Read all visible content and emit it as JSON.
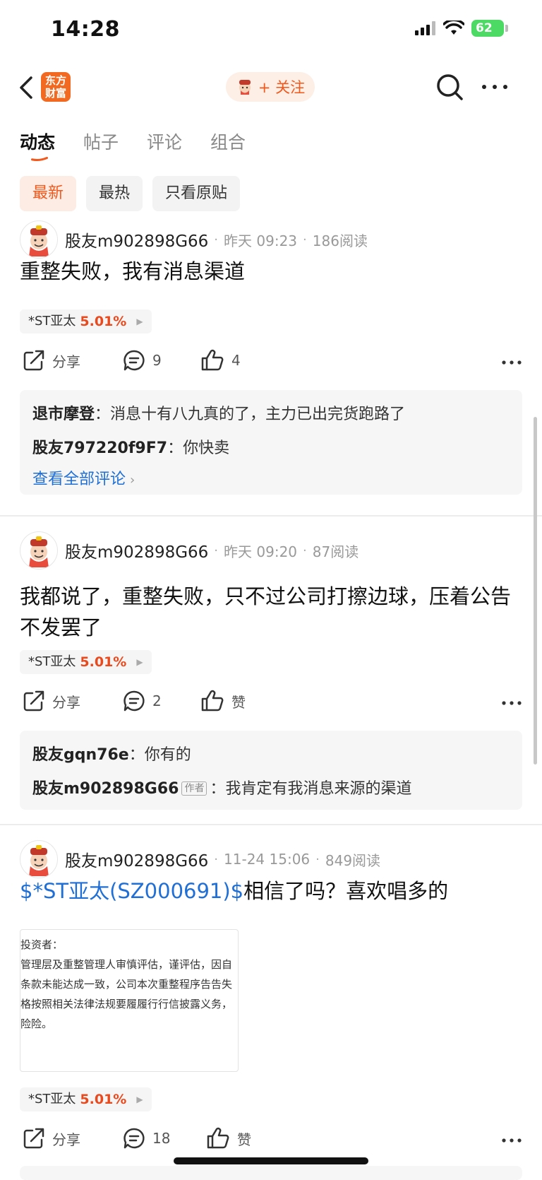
{
  "status_bar": {
    "time": "14:28",
    "battery": "62"
  },
  "nav": {
    "logo_text_line1": "东方",
    "logo_text_line2": "财富",
    "follow_label": "+ 关注"
  },
  "tabs": [
    "动态",
    "帖子",
    "评论",
    "组合"
  ],
  "filters": [
    "最新",
    "最热",
    "只看原贴"
  ],
  "posts": [
    {
      "author": "股友m902898G66",
      "time": "昨天 09:23",
      "reads": "186阅读",
      "text": "重整失败，我有消息渠道",
      "stock_name": "*ST亚太",
      "stock_pct": "5.01%",
      "share_label": "分享",
      "comments_count": "9",
      "likes": "4",
      "comments": [
        {
          "name": "退市摩登",
          "text": "消息十有八九真的了，主力已出完货跑路了"
        },
        {
          "name": "股友797220f9F7",
          "text": "你快卖"
        }
      ],
      "view_all": "查看全部评论"
    },
    {
      "author": "股友m902898G66",
      "time": "昨天 09:20",
      "reads": "87阅读",
      "text": "我都说了，重整失败，只不过公司打擦边球，压着公告不发罢了",
      "stock_name": "*ST亚太",
      "stock_pct": "5.01%",
      "share_label": "分享",
      "comments_count": "2",
      "likes": "赞",
      "comments": [
        {
          "name": "股友gqn76e",
          "text": "你有的"
        },
        {
          "name": "股友m902898G66",
          "badge": "作者",
          "text": "我肯定有我消息来源的渠道"
        }
      ]
    },
    {
      "author": "股友m902898G66",
      "time": "11-24 15:06",
      "reads": "849阅读",
      "cashtag": "$*ST亚太(SZ000691)$",
      "text": "相信了吗？喜欢唱多的",
      "image_lines": [
        "投资者：",
        "管理层及重整管理人审慎评估，谨评估，因自",
        "条款未能达成一致，公司本次重整程序告告失",
        "格按照相关法律法规要履履行行信披露义务，",
        "险险。"
      ],
      "stock_name": "*ST亚太",
      "stock_pct": "5.01%",
      "share_label": "分享",
      "comments_count": "18",
      "likes": "赞"
    }
  ],
  "colors": {
    "accent": "#f2581b",
    "link": "#1f6fd6",
    "price_up": "#e8491d"
  }
}
